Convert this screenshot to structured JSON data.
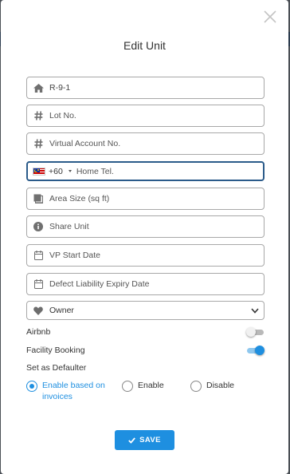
{
  "modal": {
    "title": "Edit Unit",
    "close_icon": "close-icon"
  },
  "fields": {
    "unit_no": {
      "value": "R-9-1",
      "icon": "home-icon"
    },
    "lot_no": {
      "placeholder": "Lot No.",
      "icon": "hash-icon"
    },
    "virtual_account_no": {
      "placeholder": "Virtual Account No.",
      "icon": "hash-icon"
    },
    "home_tel": {
      "country_code": "+60",
      "placeholder": "Home Tel.",
      "flag": "malaysia-flag-icon"
    },
    "area_size": {
      "placeholder": "Area Size (sq ft)",
      "icon": "area-icon"
    },
    "share_unit": {
      "placeholder": "Share Unit",
      "icon": "info-icon"
    },
    "vp_start_date": {
      "placeholder": "VP Start Date",
      "icon": "calendar-icon"
    },
    "defect_liability_expiry": {
      "placeholder": "Defect Liability Expiry Date",
      "icon": "calendar-icon"
    },
    "owner_type": {
      "selected": "Owner",
      "icon": "heart-icon"
    }
  },
  "toggles": {
    "airbnb": {
      "label": "Airbnb",
      "on": false
    },
    "facility_booking": {
      "label": "Facility Booking",
      "on": true
    }
  },
  "defaulter": {
    "label": "Set as Defaulter",
    "options": [
      {
        "label": "Enable based on invoices",
        "checked": true
      },
      {
        "label": "Enable",
        "checked": false
      },
      {
        "label": "Disable",
        "checked": false
      }
    ]
  },
  "save_button": {
    "label": "SAVE",
    "icon": "check-icon"
  },
  "colors": {
    "accent": "#1e8fe0",
    "focus_border": "#2b5b8a",
    "field_border": "#a8a8a8",
    "backdrop": "#4a4f55"
  }
}
